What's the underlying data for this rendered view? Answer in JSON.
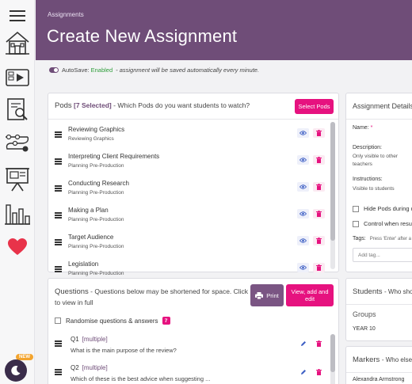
{
  "header": {
    "breadcrumb": "Assignments",
    "title": "Create New Assignment",
    "color": "#6f4d78"
  },
  "sidebar": {
    "items": [
      {
        "name": "menu-icon"
      },
      {
        "name": "home-icon"
      },
      {
        "name": "video-icon"
      },
      {
        "name": "search-document-icon"
      },
      {
        "name": "pathway-icon"
      },
      {
        "name": "presentation-icon"
      },
      {
        "name": "bar-chart-icon"
      },
      {
        "name": "heart-icon"
      }
    ],
    "new_badge": "NEW",
    "theme_toggle": "moon-icon"
  },
  "autosave": {
    "label": "AutoSave:",
    "status": "Enabled",
    "note": "- assignment will be saved automatically every minute."
  },
  "pods": {
    "title": "Pods",
    "selected": "[7 Selected]",
    "subtitle": "- Which Pods do you want students to watch?",
    "select_button": "Select Pods",
    "items": [
      {
        "title": "Reviewing Graphics",
        "subtitle": "Reviewing Graphics"
      },
      {
        "title": "Interpreting Client Requirements",
        "subtitle": "Planning Pre-Production"
      },
      {
        "title": "Conducting Research",
        "subtitle": "Planning Pre-Production"
      },
      {
        "title": "Making a Plan",
        "subtitle": "Planning Pre-Production"
      },
      {
        "title": "Target Audience",
        "subtitle": "Planning Pre-Production"
      },
      {
        "title": "Legislation",
        "subtitle": "Planning Pre-Production"
      }
    ]
  },
  "questions": {
    "title": "Questions",
    "subtitle": "- Questions below may be shortened for space. Click to view in full",
    "print_button": "Print",
    "view_button": "View, add and edit",
    "randomise_label": "Randomise questions & answers",
    "count": "7",
    "items": [
      {
        "number": "Q1",
        "type": "[multiple]",
        "text": "What is the main purpose of the review?"
      },
      {
        "number": "Q2",
        "type": "[multiple]",
        "text": "Which of these is the best advice when suggesting ..."
      }
    ]
  },
  "details": {
    "title": "Assignment Details",
    "name_label": "Name:",
    "required_mark": "*",
    "description_label": "Description:",
    "description_note_1": "Only visible to other",
    "description_note_2": "teachers",
    "instructions_label": "Instructions:",
    "instructions_note": "Visible to students",
    "hide_pods_label": "Hide Pods during quiz",
    "control_label": "Control when results",
    "tags_label": "Tags:",
    "tags_hint": "Press 'Enter' after a",
    "tag_placeholder": "Add tag..."
  },
  "students": {
    "title": "Students",
    "subtitle": "- Who should",
    "groups_label": "Groups",
    "group": "YEAR 10"
  },
  "markers": {
    "title": "Markers",
    "subtitle": "- Who else",
    "marker": "Alexandra Armstrong"
  },
  "colors": {
    "accent": "#e6127f",
    "brand": "#6f4d78",
    "enabled": "#2e9d3a"
  }
}
